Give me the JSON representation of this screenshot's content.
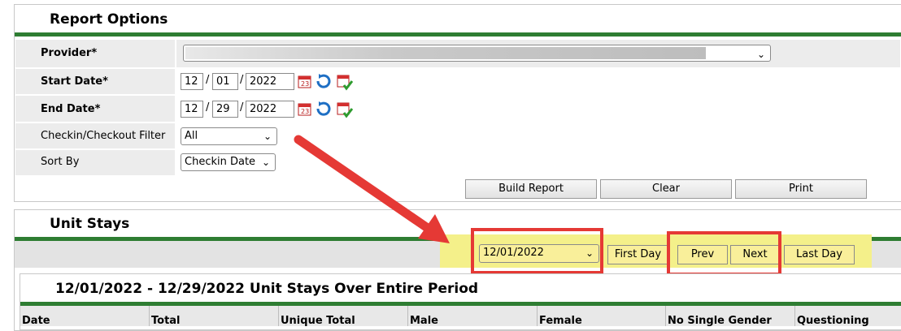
{
  "report_options": {
    "title": "Report Options",
    "provider_label": "Provider",
    "start_date_label": "Start Date",
    "end_date_label": "End Date",
    "required_marker": "*",
    "start_date": {
      "month": "12",
      "day": "01",
      "year": "2022"
    },
    "end_date": {
      "month": "12",
      "day": "29",
      "year": "2022"
    },
    "date_separator": "/",
    "checkin_filter_label": "Checkin/Checkout Filter",
    "checkin_filter_value": "All",
    "sort_by_label": "Sort By",
    "sort_by_value": "Checkin Date",
    "buttons": {
      "build": "Build Report",
      "clear": "Clear",
      "print": "Print"
    }
  },
  "unit_stays": {
    "title": "Unit Stays",
    "day_select_value": "12/01/2022",
    "nav": {
      "first": "First Day",
      "prev": "Prev",
      "next": "Next",
      "last": "Last Day"
    },
    "subtitle": "12/01/2022 - 12/29/2022 Unit Stays Over Entire Period",
    "columns": [
      "Date",
      "Total",
      "Unique Total",
      "Male",
      "Female",
      "No Single Gender",
      "Questioning"
    ]
  },
  "icons": [
    "calendar-icon",
    "refresh-icon",
    "calendar-check-icon",
    "chevron-down-icon"
  ],
  "colors": {
    "accent_green": "#2e7d32",
    "highlight_yellow": "#f4f08a",
    "annotation_red": "#e53935"
  }
}
